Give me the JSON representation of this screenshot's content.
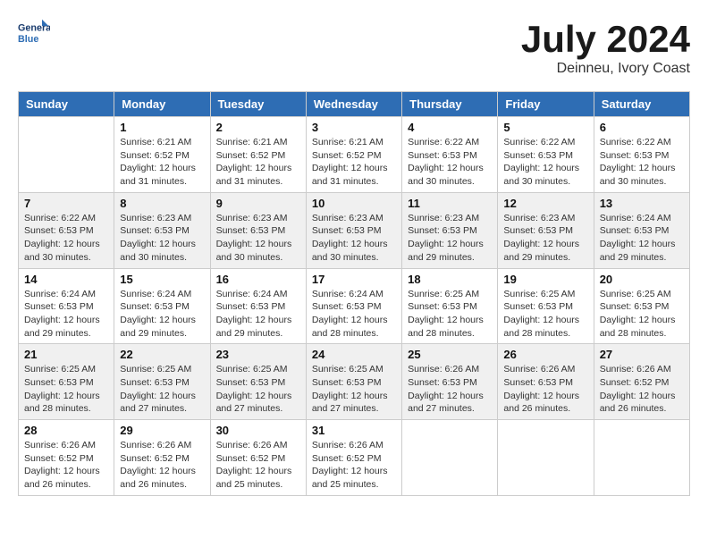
{
  "header": {
    "logo_line1": "General",
    "logo_line2": "Blue",
    "month": "July 2024",
    "location": "Deinneu, Ivory Coast"
  },
  "weekdays": [
    "Sunday",
    "Monday",
    "Tuesday",
    "Wednesday",
    "Thursday",
    "Friday",
    "Saturday"
  ],
  "weeks": [
    [
      {
        "day": "",
        "info": ""
      },
      {
        "day": "1",
        "info": "Sunrise: 6:21 AM\nSunset: 6:52 PM\nDaylight: 12 hours\nand 31 minutes."
      },
      {
        "day": "2",
        "info": "Sunrise: 6:21 AM\nSunset: 6:52 PM\nDaylight: 12 hours\nand 31 minutes."
      },
      {
        "day": "3",
        "info": "Sunrise: 6:21 AM\nSunset: 6:52 PM\nDaylight: 12 hours\nand 31 minutes."
      },
      {
        "day": "4",
        "info": "Sunrise: 6:22 AM\nSunset: 6:53 PM\nDaylight: 12 hours\nand 30 minutes."
      },
      {
        "day": "5",
        "info": "Sunrise: 6:22 AM\nSunset: 6:53 PM\nDaylight: 12 hours\nand 30 minutes."
      },
      {
        "day": "6",
        "info": "Sunrise: 6:22 AM\nSunset: 6:53 PM\nDaylight: 12 hours\nand 30 minutes."
      }
    ],
    [
      {
        "day": "7",
        "info": "Sunrise: 6:22 AM\nSunset: 6:53 PM\nDaylight: 12 hours\nand 30 minutes."
      },
      {
        "day": "8",
        "info": "Sunrise: 6:23 AM\nSunset: 6:53 PM\nDaylight: 12 hours\nand 30 minutes."
      },
      {
        "day": "9",
        "info": "Sunrise: 6:23 AM\nSunset: 6:53 PM\nDaylight: 12 hours\nand 30 minutes."
      },
      {
        "day": "10",
        "info": "Sunrise: 6:23 AM\nSunset: 6:53 PM\nDaylight: 12 hours\nand 30 minutes."
      },
      {
        "day": "11",
        "info": "Sunrise: 6:23 AM\nSunset: 6:53 PM\nDaylight: 12 hours\nand 29 minutes."
      },
      {
        "day": "12",
        "info": "Sunrise: 6:23 AM\nSunset: 6:53 PM\nDaylight: 12 hours\nand 29 minutes."
      },
      {
        "day": "13",
        "info": "Sunrise: 6:24 AM\nSunset: 6:53 PM\nDaylight: 12 hours\nand 29 minutes."
      }
    ],
    [
      {
        "day": "14",
        "info": "Sunrise: 6:24 AM\nSunset: 6:53 PM\nDaylight: 12 hours\nand 29 minutes."
      },
      {
        "day": "15",
        "info": "Sunrise: 6:24 AM\nSunset: 6:53 PM\nDaylight: 12 hours\nand 29 minutes."
      },
      {
        "day": "16",
        "info": "Sunrise: 6:24 AM\nSunset: 6:53 PM\nDaylight: 12 hours\nand 29 minutes."
      },
      {
        "day": "17",
        "info": "Sunrise: 6:24 AM\nSunset: 6:53 PM\nDaylight: 12 hours\nand 28 minutes."
      },
      {
        "day": "18",
        "info": "Sunrise: 6:25 AM\nSunset: 6:53 PM\nDaylight: 12 hours\nand 28 minutes."
      },
      {
        "day": "19",
        "info": "Sunrise: 6:25 AM\nSunset: 6:53 PM\nDaylight: 12 hours\nand 28 minutes."
      },
      {
        "day": "20",
        "info": "Sunrise: 6:25 AM\nSunset: 6:53 PM\nDaylight: 12 hours\nand 28 minutes."
      }
    ],
    [
      {
        "day": "21",
        "info": "Sunrise: 6:25 AM\nSunset: 6:53 PM\nDaylight: 12 hours\nand 28 minutes."
      },
      {
        "day": "22",
        "info": "Sunrise: 6:25 AM\nSunset: 6:53 PM\nDaylight: 12 hours\nand 27 minutes."
      },
      {
        "day": "23",
        "info": "Sunrise: 6:25 AM\nSunset: 6:53 PM\nDaylight: 12 hours\nand 27 minutes."
      },
      {
        "day": "24",
        "info": "Sunrise: 6:25 AM\nSunset: 6:53 PM\nDaylight: 12 hours\nand 27 minutes."
      },
      {
        "day": "25",
        "info": "Sunrise: 6:26 AM\nSunset: 6:53 PM\nDaylight: 12 hours\nand 27 minutes."
      },
      {
        "day": "26",
        "info": "Sunrise: 6:26 AM\nSunset: 6:53 PM\nDaylight: 12 hours\nand 26 minutes."
      },
      {
        "day": "27",
        "info": "Sunrise: 6:26 AM\nSunset: 6:52 PM\nDaylight: 12 hours\nand 26 minutes."
      }
    ],
    [
      {
        "day": "28",
        "info": "Sunrise: 6:26 AM\nSunset: 6:52 PM\nDaylight: 12 hours\nand 26 minutes."
      },
      {
        "day": "29",
        "info": "Sunrise: 6:26 AM\nSunset: 6:52 PM\nDaylight: 12 hours\nand 26 minutes."
      },
      {
        "day": "30",
        "info": "Sunrise: 6:26 AM\nSunset: 6:52 PM\nDaylight: 12 hours\nand 25 minutes."
      },
      {
        "day": "31",
        "info": "Sunrise: 6:26 AM\nSunset: 6:52 PM\nDaylight: 12 hours\nand 25 minutes."
      },
      {
        "day": "",
        "info": ""
      },
      {
        "day": "",
        "info": ""
      },
      {
        "day": "",
        "info": ""
      }
    ]
  ]
}
